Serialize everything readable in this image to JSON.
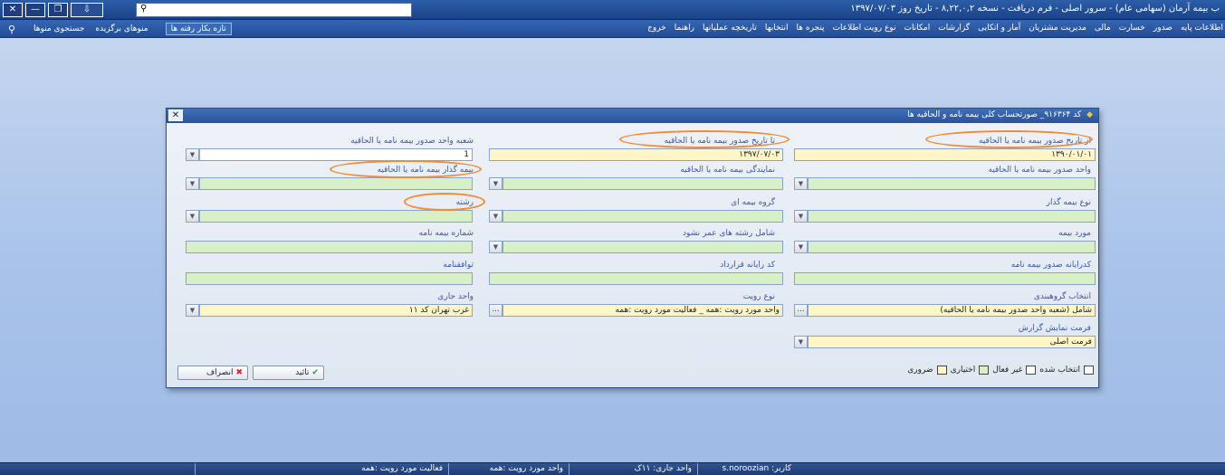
{
  "window": {
    "title": "ب بیمه آرمان (سهامی عام) - سرور اصلی - فرم دریافت - نسخه ۸,۲۲,۰,۲ - تاریخ روز ۱۳۹۷/۰۷/۰۳",
    "close_glyph": "✕",
    "minimize_glyph": "—",
    "restore_glyph": "❐",
    "pin_glyph": "⇩",
    "search_icon_glyph": "⚲"
  },
  "menubar": {
    "search_icon_glyph": "⚲",
    "left_items": [
      "جستجوی منوها",
      "منوهای برگزیده",
      "تازه بکار رفته ها"
    ],
    "right_items": [
      "اطلاعات پایه",
      "صدور",
      "خسارت",
      "مالی",
      "مدیریت مشتریان",
      "آمار و اتکایی",
      "گزارشات",
      "امکانات",
      "نوع رویت اطلاعات",
      "پنجره ها",
      "انتخابها",
      "تاریخچه عملیاتها",
      "راهنما",
      "خروج"
    ]
  },
  "dialog": {
    "title": "کد ۹۱۶۳۶۴_ صورتحساب کلی بیمه نامه و الحاقیه ها",
    "close_glyph": "✕",
    "title_icon_glyph": "◆",
    "fields": {
      "from_date": {
        "label": "از تاریخ صدور بیمه نامه یا الحاقیه",
        "value": "۱۳۹۰/۰۱/۰۱"
      },
      "to_date": {
        "label": "تا تاریخ صدور بیمه نامه یا الحاقیه",
        "value": "۱۳۹۷/۰۷/۰۳"
      },
      "issuer_branch": {
        "label": "شعبه واحد صدور بیمه نامه یا الحاقیه",
        "value": "1"
      },
      "issuing_unit": {
        "label": "واحد صدور بیمه نامه یا الحاقیه",
        "value": ""
      },
      "agency": {
        "label": "نمایندگی بیمه نامه یا الحاقیه",
        "value": ""
      },
      "policyholder": {
        "label": "بیمه گذار بیمه نامه یا الحاقیه",
        "value": ""
      },
      "policyholder_type": {
        "label": "نوع بیمه گذار",
        "value": ""
      },
      "insurance_group": {
        "label": "گروه بیمه ای",
        "value": ""
      },
      "line": {
        "label": "رشته",
        "value": ""
      },
      "insurance_subject": {
        "label": "مورد بیمه",
        "value": ""
      },
      "excluded_lines": {
        "label": "شامل رشته های عمر نشود",
        "value": ""
      },
      "policy_number": {
        "label": "شماره بیمه نامه",
        "value": ""
      },
      "issue_code": {
        "label": "کدرایانه صدور بیمه نامه",
        "value": ""
      },
      "contract_code": {
        "label": "کد رایانه قرارداد",
        "value": ""
      },
      "agreement": {
        "label": "توافقنامه",
        "value": ""
      },
      "grouping": {
        "label": "انتخاب گروهبندی",
        "value": "شامل (شعبه واحد صدور بیمه نامه یا الحاقیه)"
      },
      "view_type": {
        "label": "نوع رویت",
        "value": "واحد مورد رویت :همه _ فعالیت مورد رویت :همه"
      },
      "current_unit": {
        "label": "واحد جاری",
        "value": "غرب تهران کد ۱۱"
      },
      "report_format": {
        "label": "فرمت نمایش گزارش",
        "value": "فرمت اصلی"
      }
    },
    "buttons": {
      "confirm": "تائید",
      "cancel": "انصراف",
      "confirm_glyph": "✔",
      "cancel_glyph": "✖"
    },
    "legend": [
      {
        "label": "ضروری",
        "color": "#fff6c8"
      },
      {
        "label": "اختیاری",
        "color": "#d8f0c8"
      },
      {
        "label": "غیر فعال",
        "color": "#ffffff"
      },
      {
        "label": "انتخاب شده",
        "color": "#ffffff"
      }
    ]
  },
  "statusbar": {
    "user": "کاربر: s.noroozian",
    "current_unit": "واحد جاری: ۱۱ک",
    "view_unit": "واحد مورد رویت :همه",
    "activity": "فعالیت مورد رویت :همه"
  },
  "colors": {
    "required": "#fff6c8",
    "optional": "#d8f0c8",
    "highlight": "#f28b32",
    "title_bar": "#1b4288"
  }
}
